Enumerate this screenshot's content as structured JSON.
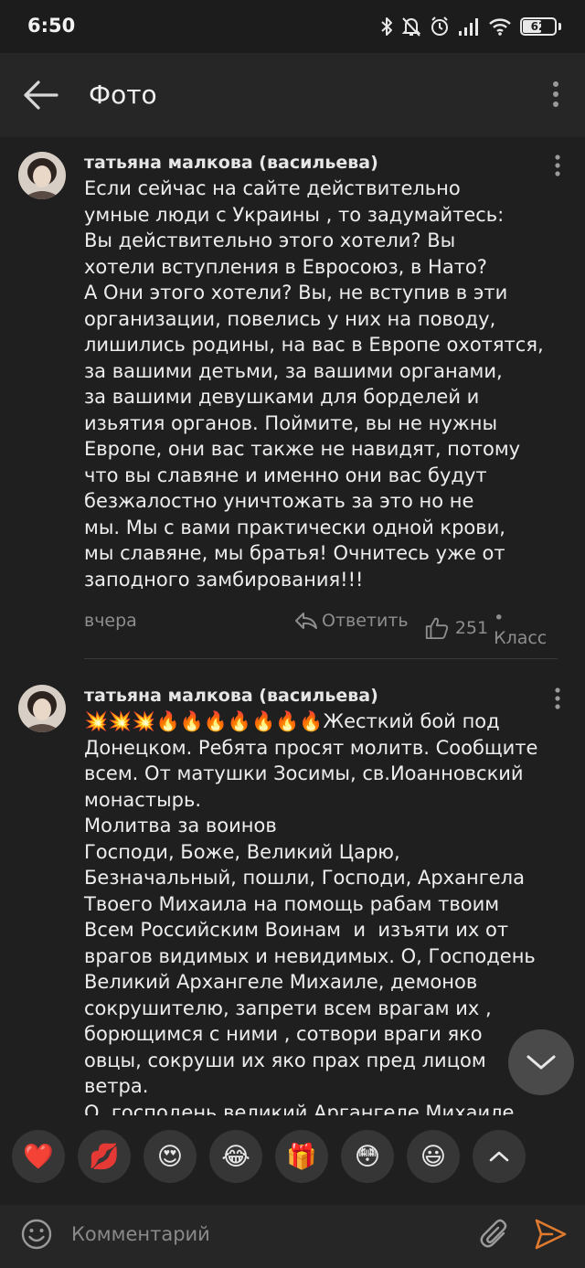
{
  "status_bar": {
    "time": "6:50",
    "battery_level": 62,
    "battery_text": "62",
    "icons": [
      "bluetooth-icon",
      "mute-icon",
      "alarm-icon",
      "signal-icon",
      "wifi-icon",
      "battery-icon"
    ]
  },
  "app_bar": {
    "title": "Фото",
    "back_icon": "arrow-left-icon",
    "menu_icon": "more-vertical-icon"
  },
  "comments": [
    {
      "author": "татьяна малкова (васильева)",
      "text": "Если сейчас на сайте действительно\nумные люди с Украины , то задумайтесь:\nВы действительно этого хотели? Вы\nхотели вступления в Евросоюз, в Нато?\nА Они этого хотели? Вы, не вступив в эти\nорганизации, повелись у них на поводу,\nлишились родины, на вас в Европе охотятся,\nза вашими детьми, за вашими органами,\nза вашими девушками для борделей и\nизьятия органов. Поймите, вы не нужны\nЕвропе, они вас также не навидят, потому\nчто вы славяне и именно они вас будут\nбезжалостно уничтожать за это но не\nмы. Мы с вами практически одной крови,\nмы славяне, мы братья! Очнитесь уже от\nзаподного замбирования!!!",
      "date": "вчера",
      "reply_label": "Ответить",
      "likes_count": "251",
      "likes_label": "• Класс"
    },
    {
      "author": "татьяна малкова (васильева)",
      "text": "💥💥💥🔥🔥🔥🔥🔥🔥🔥Жесткий бой под\nДонецком. Ребята просят молитв. Сообщите\nвсем. От матушки Зосимы, св.Иоанновский\nмонастырь.\nМолитва за воинов\nГосподи, Боже, Великий Царю,\nБезначальный, пошли, Господи, Архангела\nТвоего Михаила на помощь рабам твоим\nВсем Российским Воинам  и  изъяти их от\nврагов видимых и невидимых. О, Господень\nВеликий Архангеле Михаиле, демонов\nсокрушителю, запрети всем врагам их ,\nборющимся с ними , сотвори враги яко\nовцы, сокруши их яко прах пред лицом\nветра.\nО, господень великий Аргангеле Михаиле,"
    }
  ],
  "reactions": [
    {
      "name": "heart",
      "glyph": "❤️"
    },
    {
      "name": "kiss",
      "glyph": "💋"
    },
    {
      "name": "heart-eyes",
      "glyph": "😍"
    },
    {
      "name": "laughing",
      "glyph": "😂"
    },
    {
      "name": "gift",
      "glyph": "🎁"
    },
    {
      "name": "flushed",
      "glyph": "😳"
    },
    {
      "name": "smile",
      "glyph": "😃"
    }
  ],
  "input": {
    "placeholder": "Комментарий",
    "value": ""
  },
  "colors": {
    "background": "#1f1f1f",
    "app_bar": "#262626",
    "muted_text": "#8e8e8e",
    "send_accent": "#e07a2e"
  }
}
